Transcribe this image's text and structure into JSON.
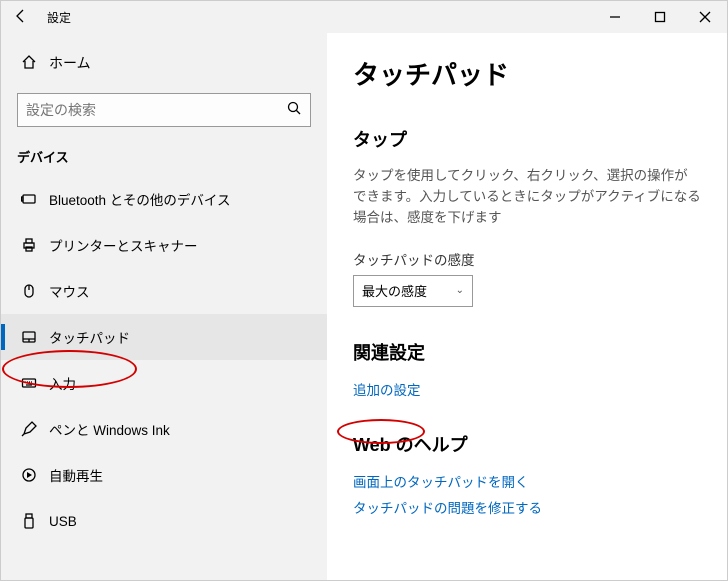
{
  "titlebar": {
    "title": "設定"
  },
  "sidebar": {
    "home_label": "ホーム",
    "search_placeholder": "設定の検索",
    "category": "デバイス",
    "items": [
      {
        "label": "Bluetooth とその他のデバイス"
      },
      {
        "label": "プリンターとスキャナー"
      },
      {
        "label": "マウス"
      },
      {
        "label": "タッチパッド"
      },
      {
        "label": "入力"
      },
      {
        "label": "ペンと Windows Ink"
      },
      {
        "label": "自動再生"
      },
      {
        "label": "USB"
      }
    ]
  },
  "content": {
    "page_title": "タッチパッド",
    "tap_heading": "タップ",
    "tap_desc": "タップを使用してクリック、右クリック、選択の操作ができます。入力しているときにタップがアクティブになる場合は、感度を下げます",
    "sensitivity_label": "タッチパッドの感度",
    "sensitivity_value": "最大の感度",
    "related_heading": "関連設定",
    "related_link": "追加の設定",
    "help_heading": "Web のヘルプ",
    "help_link_1": "画面上のタッチパッドを開く",
    "help_link_2": "タッチパッドの問題を修正する"
  }
}
